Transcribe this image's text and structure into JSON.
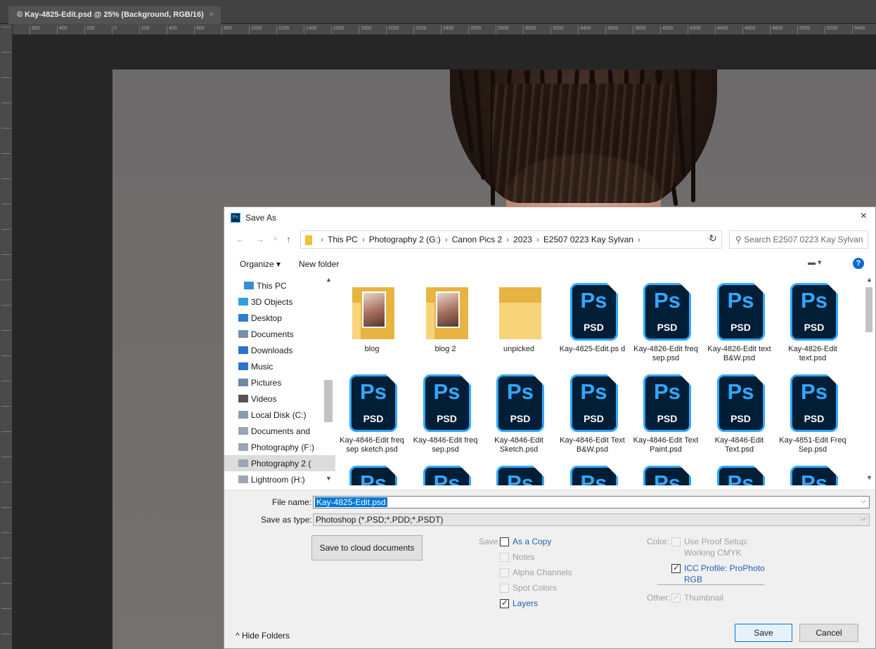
{
  "document_tab": {
    "title": "© Kay-4825-Edit.psd @ 25% (Background, RGB/16)",
    "close": "×"
  },
  "ruler": {
    "ticks": [
      "600",
      "400",
      "200",
      "0",
      "200",
      "400",
      "600",
      "800",
      "1000",
      "1200",
      "1400",
      "1600",
      "1800",
      "2000",
      "2200",
      "2400",
      "2600",
      "2800",
      "3000",
      "3200",
      "3400",
      "3600",
      "3800",
      "4000",
      "4200",
      "4400",
      "4600",
      "4800",
      "5000",
      "5200",
      "5400"
    ]
  },
  "dialog": {
    "title": "Save As",
    "app_badge": "Ps",
    "close": "×",
    "nav": {
      "back": "←",
      "forward": "→",
      "recent": "˅",
      "up": "↑"
    },
    "breadcrumbs": [
      "This PC",
      "Photography 2 (G:)",
      "Canon Pics 2",
      "2023",
      "E2507 0223 Kay Sylvan"
    ],
    "breadcrumb_sep": "›",
    "address_dropdown": "⌵",
    "refresh": "↻",
    "search_placeholder": "⚲ Search E2507 0223 Kay Sylvan",
    "toolbar": {
      "organize": "Organize ▾",
      "new_folder": "New folder",
      "view": "▬ ▾",
      "help": "?"
    },
    "nav_pane": [
      {
        "label": "This PC",
        "icon": "pc-icon",
        "color": "#3a8ad6"
      },
      {
        "label": "3D Objects",
        "icon": "cube-icon",
        "color": "#33a0e0"
      },
      {
        "label": "Desktop",
        "icon": "desktop-icon",
        "color": "#2f7fd0"
      },
      {
        "label": "Documents",
        "icon": "document-icon",
        "color": "#7a8fa8"
      },
      {
        "label": "Downloads",
        "icon": "download-icon",
        "color": "#2a74c9"
      },
      {
        "label": "Music",
        "icon": "music-icon",
        "color": "#2a74c9"
      },
      {
        "label": "Pictures",
        "icon": "pictures-icon",
        "color": "#6e88a6"
      },
      {
        "label": "Videos",
        "icon": "videos-icon",
        "color": "#555"
      },
      {
        "label": "Local Disk (C:)",
        "icon": "drive-icon",
        "color": "#8a9bb0"
      },
      {
        "label": "Documents and",
        "icon": "network-drive-icon",
        "color": "#9aa6b4"
      },
      {
        "label": "Photography (F:)",
        "icon": "network-drive-icon",
        "color": "#9aa6b4"
      },
      {
        "label": "Photography 2 (",
        "icon": "network-drive-icon",
        "color": "#9aa6b4"
      },
      {
        "label": "Lightroom (H:)",
        "icon": "network-drive-icon",
        "color": "#9aa6b4"
      }
    ],
    "files": [
      {
        "name": "blog",
        "kind": "folder-photo"
      },
      {
        "name": "blog 2",
        "kind": "folder-photo"
      },
      {
        "name": "unpicked",
        "kind": "folder"
      },
      {
        "name": "Kay-4825-Edit.ps d",
        "kind": "psd"
      },
      {
        "name": "Kay-4826-Edit freq sep.psd",
        "kind": "psd"
      },
      {
        "name": "Kay-4826-Edit text B&W.psd",
        "kind": "psd"
      },
      {
        "name": "Kay-4826-Edit text.psd",
        "kind": "psd"
      },
      {
        "name": "Kay-4846-Edit freq sep sketch.psd",
        "kind": "psd"
      },
      {
        "name": "Kay-4846-Edit freq sep.psd",
        "kind": "psd"
      },
      {
        "name": "Kay-4846-Edit Sketch.psd",
        "kind": "psd"
      },
      {
        "name": "Kay-4846-Edit Text B&W.psd",
        "kind": "psd"
      },
      {
        "name": "Kay-4846-Edit Text Paint.psd",
        "kind": "psd"
      },
      {
        "name": "Kay-4846-Edit Text.psd",
        "kind": "psd"
      },
      {
        "name": "Kay-4851-Edit Freq Sep.psd",
        "kind": "psd"
      },
      {
        "name": "",
        "kind": "psd"
      },
      {
        "name": "",
        "kind": "psd"
      },
      {
        "name": "",
        "kind": "psd"
      },
      {
        "name": "",
        "kind": "psd"
      },
      {
        "name": "",
        "kind": "psd"
      },
      {
        "name": "",
        "kind": "psd"
      },
      {
        "name": "",
        "kind": "psd"
      }
    ],
    "psd_icon": {
      "ps": "Ps",
      "label": "PSD"
    },
    "file_name_label": "File name:",
    "file_name_value": "Kay-4825-Edit.psd",
    "save_type_label": "Save as type:",
    "save_type_value": "Photoshop (*.PSD;*.PDD;*.PSDT)",
    "cloud_button": "Save to cloud documents",
    "save_options": {
      "label": "Save:",
      "as_a_copy": "As a Copy",
      "notes": "Notes",
      "alpha_channels": "Alpha Channels",
      "spot_colors": "Spot Colors",
      "layers": "Layers"
    },
    "color_options": {
      "label": "Color:",
      "use_proof_setup": "Use Proof Setup:",
      "working_cmyk": "Working CMYK",
      "icc_profile": "ICC Profile:  ProPhoto",
      "icc_profile_cont": "RGB"
    },
    "other_options": {
      "label": "Other:",
      "thumbnail": "Thumbnail"
    },
    "hide_folders": "^ Hide Folders",
    "save_button": "Save",
    "cancel_button": "Cancel"
  }
}
